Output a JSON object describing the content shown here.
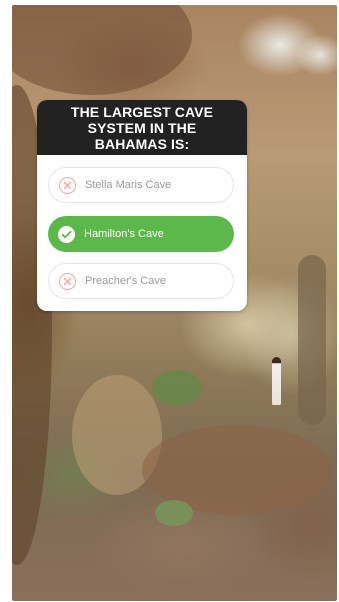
{
  "quiz": {
    "question": "THE LARGEST CAVE SYSTEM IN THE BAHAMAS IS:",
    "options": [
      {
        "label": "Stella Maris Cave",
        "state": "incorrect",
        "icon": "x-circle-icon"
      },
      {
        "label": "Hamilton's Cave",
        "state": "correct",
        "icon": "check-circle-icon"
      },
      {
        "label": "Preacher's Cave",
        "state": "incorrect",
        "icon": "x-circle-icon"
      }
    ]
  },
  "colors": {
    "header_bg": "#222222",
    "correct": "#5cb84a",
    "incorrect_icon": "#f0a5a0",
    "incorrect_text": "#9a9a9a"
  }
}
